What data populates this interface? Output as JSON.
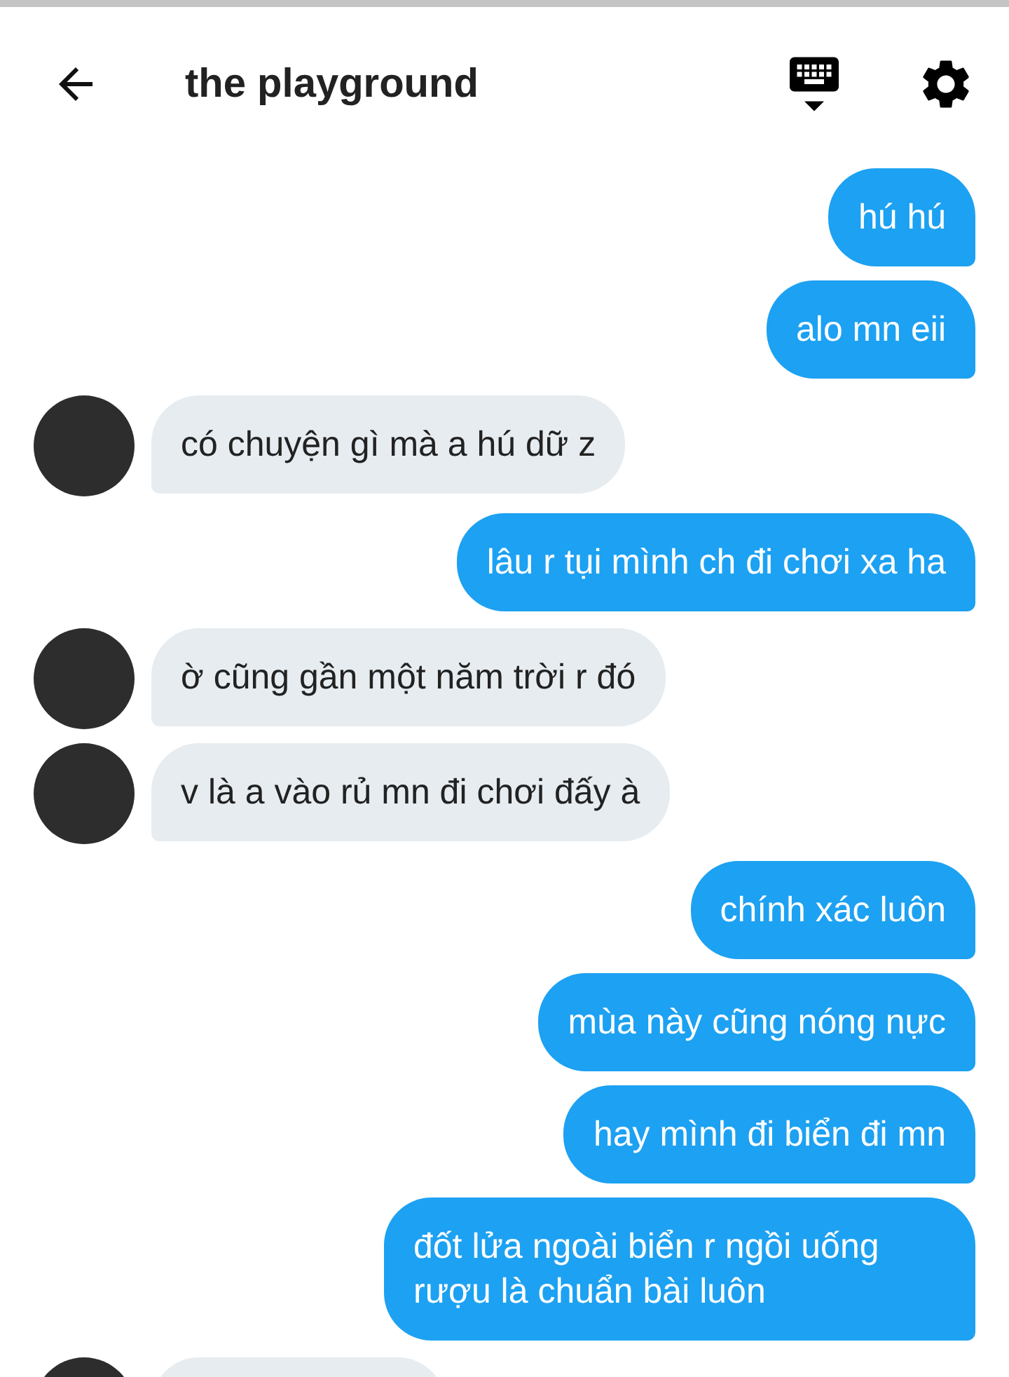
{
  "header": {
    "title": "the playground"
  },
  "messages": [
    {
      "kind": "sent",
      "text": "hú hú"
    },
    {
      "kind": "sent",
      "text": "alo mn eii"
    },
    {
      "kind": "received",
      "text": "có chuyện gì mà a hú dữ z"
    },
    {
      "kind": "sent",
      "text": "lâu r tụi mình ch đi chơi xa ha"
    },
    {
      "kind": "received",
      "text": "ờ cũng gần một năm trời r đó"
    },
    {
      "kind": "received",
      "text": "v là a vào rủ mn đi chơi đấy à"
    },
    {
      "kind": "sent",
      "text": "chính xác luôn"
    },
    {
      "kind": "sent",
      "text": "mùa này cũng nóng nực"
    },
    {
      "kind": "sent",
      "text": "hay mình đi biển đi mn"
    },
    {
      "kind": "sent",
      "text": "đốt lửa ngoài biển r ngồi uống rượu là chuẩn bài luôn"
    },
    {
      "kind": "received"
    }
  ]
}
